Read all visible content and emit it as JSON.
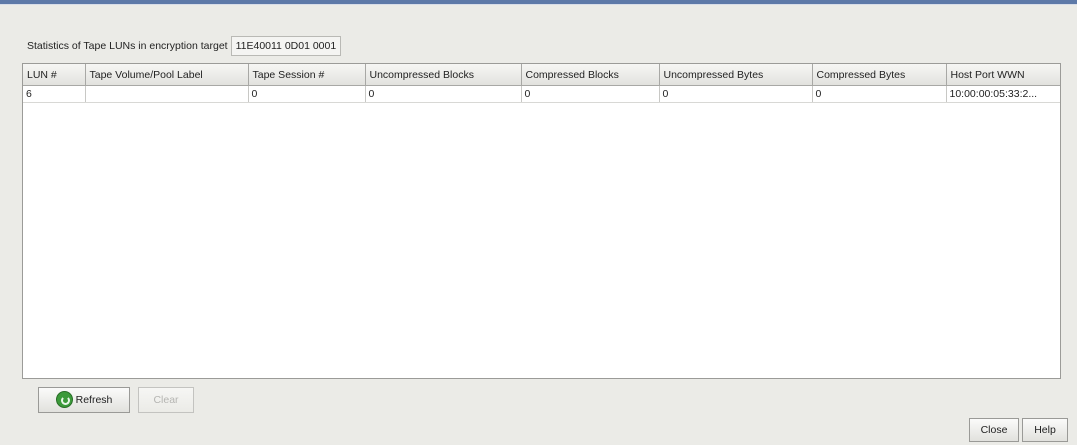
{
  "target": {
    "label": "Statistics of Tape LUNs in encryption target",
    "value": "11E40011 0D01 0001"
  },
  "table": {
    "headers": [
      "LUN #",
      "Tape Volume/Pool Label",
      "Tape Session #",
      "Uncompressed Blocks",
      "Compressed Blocks",
      "Uncompressed Bytes",
      "Compressed Bytes",
      "Host Port WWN"
    ],
    "rows": [
      [
        "6",
        "",
        "0",
        "0",
        "0",
        "0",
        "0",
        "10:00:00:05:33:2..."
      ]
    ]
  },
  "buttons": {
    "refresh": "Refresh",
    "clear": "Clear",
    "close": "Close",
    "help": "Help"
  }
}
